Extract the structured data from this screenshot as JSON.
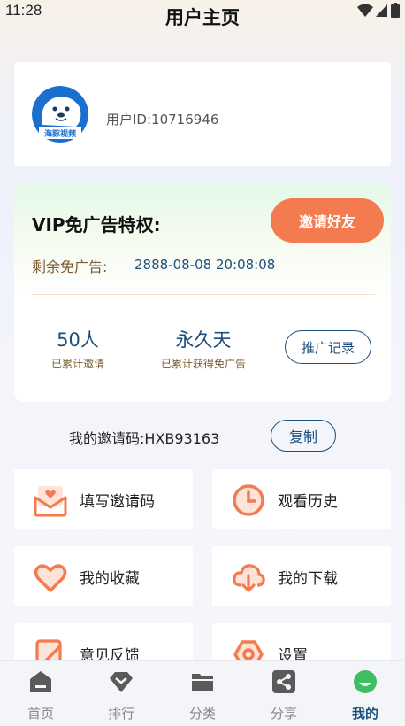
{
  "status": {
    "time": "11:28"
  },
  "page": {
    "title": "用户主页"
  },
  "profile": {
    "user_id_label": "用户ID:10716946",
    "logo_text": "海豚视频"
  },
  "vip": {
    "title": "VIP免广告特权:",
    "invite_button": "邀请好友",
    "remain_label": "剩余免广告:",
    "remain_date": "2888-08-08 20:08:08",
    "stats": [
      {
        "value": "50人",
        "label": "已累计邀请"
      },
      {
        "value": "永久天",
        "label": "已累计获得免广告"
      }
    ],
    "record_button": "推广记录"
  },
  "invite_code": {
    "label": "我的邀请码:",
    "code": "HXB93163",
    "copy_button": "复制"
  },
  "menu": [
    {
      "label": "填写邀请码",
      "icon": "envelope-heart-icon"
    },
    {
      "label": "观看历史",
      "icon": "clock-icon"
    },
    {
      "label": "我的收藏",
      "icon": "heart-icon"
    },
    {
      "label": "我的下载",
      "icon": "cloud-download-icon"
    },
    {
      "label": "意见反馈",
      "icon": "edit-icon"
    },
    {
      "label": "设置",
      "icon": "gear-icon"
    }
  ],
  "tabs": [
    {
      "label": "首页",
      "icon": "home-icon"
    },
    {
      "label": "排行",
      "icon": "ranking-icon"
    },
    {
      "label": "分类",
      "icon": "folder-icon"
    },
    {
      "label": "分享",
      "icon": "share-icon"
    },
    {
      "label": "我的",
      "icon": "profile-icon",
      "active": true
    }
  ],
  "colors": {
    "accent": "#1d4f7d",
    "orange": "#f47a4f",
    "gold": "#7b5b2c"
  }
}
